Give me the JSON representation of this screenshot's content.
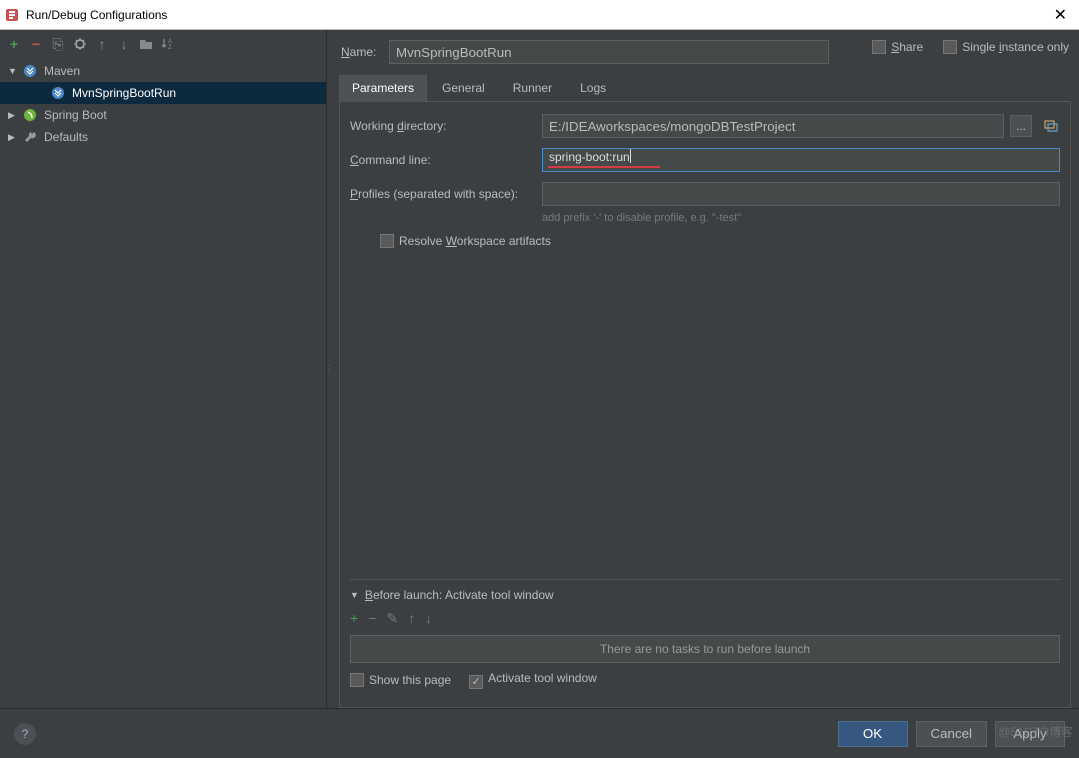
{
  "window": {
    "title": "Run/Debug Configurations",
    "close": "✕"
  },
  "toolbar": {
    "add": "+",
    "del": "−",
    "copy_icon": "⎘",
    "wrench_icon": "⚙",
    "up_icon": "⬆",
    "down_icon": "⬇",
    "folder_icon": "📁",
    "sort_icon": "↓²"
  },
  "tree": {
    "items": [
      {
        "expanded": true,
        "icon": "maven",
        "label": "Maven",
        "depth": 0
      },
      {
        "selected": true,
        "icon": "maven",
        "label": "MvnSpringBootRun",
        "depth": 1
      },
      {
        "expanded": false,
        "icon": "spring",
        "label": "Spring Boot",
        "depth": 0
      },
      {
        "expanded": false,
        "icon": "defaults",
        "label": "Defaults",
        "depth": 0
      }
    ]
  },
  "form": {
    "name_label": "Name:",
    "name_value": "MvnSpringBootRun",
    "share_label": "Share",
    "single_instance_label": "Single instance only",
    "tabs": [
      {
        "label": "Parameters",
        "active": true
      },
      {
        "label": "General",
        "active": false
      },
      {
        "label": "Runner",
        "active": false
      },
      {
        "label": "Logs",
        "active": false
      }
    ],
    "working_dir_label": "Working directory:",
    "working_dir_value": "E:/IDEAworkspaces/mongoDBTestProject",
    "browse_dots": "...",
    "command_line_label": "Command line:",
    "command_line_value": "spring-boot:run",
    "profiles_label": "Profiles (separated with space):",
    "profiles_hint": "add prefix '-' to disable profile, e.g. \"-test\"",
    "resolve_workspace_label": "Resolve Workspace artifacts"
  },
  "before_launch": {
    "header": "Before launch: Activate tool window",
    "empty_text": "There are no tasks to run before launch",
    "show_page_label": "Show this page",
    "activate_label": "Activate tool window"
  },
  "footer": {
    "ok": "OK",
    "cancel": "Cancel",
    "apply": "Apply",
    "help": "?"
  },
  "watermark": "@51CTO博客"
}
